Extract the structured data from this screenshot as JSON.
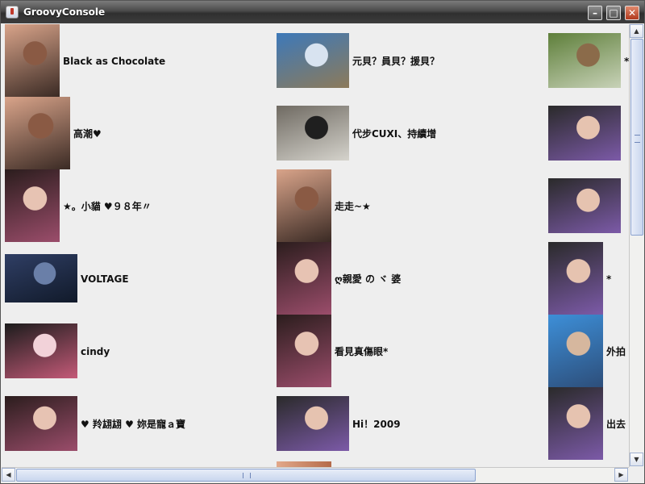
{
  "window": {
    "title": "GroovyConsole"
  },
  "items": [
    {
      "label": "Black as Chocolate",
      "thumb": "portrait-woman-icon"
    },
    {
      "label": "元貝？員貝？援貝？",
      "thumb": "beach-photo-icon"
    },
    {
      "label": "*",
      "thumb": "field-photo-icon"
    },
    {
      "label": "高潮♥",
      "thumb": "portrait-woman-icon"
    },
    {
      "label": "代步CUXI、持續增",
      "thumb": "scooters-photo-icon"
    },
    {
      "label": "",
      "thumb": "friends-photo-icon"
    },
    {
      "label": "★。小貓 ♥９８年〃",
      "thumb": "portrait-girl-icon"
    },
    {
      "label": "走走~★",
      "thumb": "portrait-woman-icon"
    },
    {
      "label": "",
      "thumb": "friends-photo-icon"
    },
    {
      "label": "VOLTAGE",
      "thumb": "jeans-photo-icon"
    },
    {
      "label": "ღ親愛 の ヾ 婆",
      "thumb": "portrait-girl-icon"
    },
    {
      "label": "*",
      "thumb": "friends-photo-icon"
    },
    {
      "label": "cindy",
      "thumb": "nails-photo-icon"
    },
    {
      "label": "看見真傷眼*",
      "thumb": "portrait-girl-icon"
    },
    {
      "label": "外拍",
      "thumb": "slide-photo-icon"
    },
    {
      "label": "♥ 羚翃翃 ♥ 妳是寵ａ寶",
      "thumb": "portrait-girl-icon"
    },
    {
      "label": "Hi！2009",
      "thumb": "friends-photo-icon"
    },
    {
      "label": "出去",
      "thumb": "friends-photo-icon"
    }
  ],
  "scrollbars": {
    "vertical": {
      "position": 0.0,
      "visible_fraction": 0.45
    },
    "horizontal": {
      "position": 0.0,
      "visible_fraction": 0.78
    }
  }
}
